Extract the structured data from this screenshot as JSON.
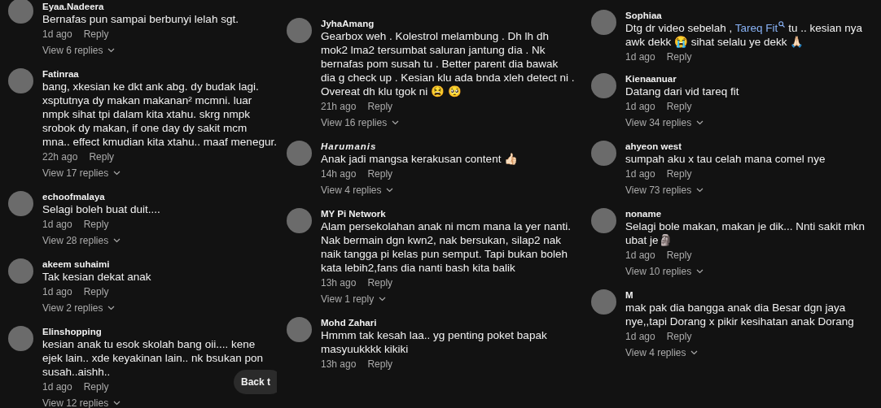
{
  "columns": [
    {
      "comments": [
        {
          "author": "Eyaa.Nadeera",
          "text": [
            {
              "kind": "plain",
              "text": "Bernafas pun sampai berbunyi lelah sgt."
            }
          ],
          "time": "1d ago",
          "reply": "Reply",
          "replies": "View 6 replies"
        },
        {
          "author": "Fatinraa",
          "text": [
            {
              "kind": "plain",
              "text": "bang, xkesian ke dkt ank abg. dy budak lagi. xsptutnya dy makan makanan² mcmni. luar nmpk sihat tpi dalam kita xtahu. skrg nmpk srobok dy makan, if one day dy sakit mcm mna.. effect kmudian kita xtahu.. maaf menegur."
            }
          ],
          "time": "22h ago",
          "reply": "Reply",
          "replies": "View 17 replies"
        },
        {
          "author": "echoofmalaya",
          "text": [
            {
              "kind": "plain",
              "text": "Selagi boleh buat duit...."
            }
          ],
          "time": "1d ago",
          "reply": "Reply",
          "replies": "View 28 replies"
        },
        {
          "author": "akeem suhaimi",
          "text": [
            {
              "kind": "plain",
              "text": "Tak kesian dekat anak"
            }
          ],
          "time": "1d ago",
          "reply": "Reply",
          "replies": "View 2 replies"
        },
        {
          "author": "Elinshopping",
          "text": [
            {
              "kind": "plain",
              "text": "kesian anak tu esok skolah bang oii.... kene ejek lain.. xde keyakinan lain.. nk bsukan pon susah..aishh.."
            }
          ],
          "time": "1d ago",
          "reply": "Reply",
          "replies": "View 12 replies"
        }
      ],
      "back_button": "Back t"
    },
    {
      "comments": [
        {
          "author": "JyhaAmang",
          "text": [
            {
              "kind": "plain",
              "text": "Gearbox weh . Kolestrol melambung . Dh lh dh mok2 lma2 tersumbat saluran jantung dia . Nk bernafas pom susah tu . Better parent dia bawak dia g check up . Kesian klu ada bnda xleh detect ni . Overeat dh klu tgok ni 😫 🥺"
            }
          ],
          "time": "21h ago",
          "reply": "Reply",
          "replies": "View 16 replies"
        },
        {
          "author": "Harumanis",
          "author_italic": true,
          "text": [
            {
              "kind": "plain",
              "text": "Anak jadi mangsa kerakusan content 👍🏻"
            }
          ],
          "time": "14h ago",
          "reply": "Reply",
          "replies": "View 4 replies"
        },
        {
          "author": "MY Pi Network",
          "text": [
            {
              "kind": "plain",
              "text": "Alam persekolahan anak ni mcm mana la yer nanti. Nak bermain dgn kwn2, nak bersukan, silap2 nak naik tangga pi kelas pun semput. Tapi bukan boleh kata lebih2,fans dia nanti bash kita balik"
            }
          ],
          "time": "13h ago",
          "reply": "Reply",
          "replies": "View 1 reply"
        },
        {
          "author": "Mohd Zahari",
          "text": [
            {
              "kind": "plain",
              "text": "Hmmm tak kesah laa.. yg penting poket bapak masyuukkkk kikiki"
            }
          ],
          "time": "13h ago",
          "reply": "Reply"
        }
      ]
    },
    {
      "comments": [
        {
          "author": "Sophiaa",
          "text": [
            {
              "kind": "plain",
              "text": "Dtg dr video sebelah , "
            },
            {
              "kind": "link",
              "text": "Tareq Fit"
            },
            {
              "kind": "plain",
              "text": " tu .. kesian nya awk dekk 😭 sihat selalu ye dekk 🙏🏻"
            }
          ],
          "time": "1d ago",
          "reply": "Reply"
        },
        {
          "author": "Kienaanuar",
          "text": [
            {
              "kind": "plain",
              "text": "Datang dari vid tareq fit"
            }
          ],
          "time": "1d ago",
          "reply": "Reply",
          "replies": "View 34 replies"
        },
        {
          "author": "ahyeon west",
          "text": [
            {
              "kind": "plain",
              "text": "sumpah aku x tau celah mana comel nye"
            }
          ],
          "time": "1d ago",
          "reply": "Reply",
          "replies": "View 73 replies"
        },
        {
          "author": "noname",
          "text": [
            {
              "kind": "plain",
              "text": "Selagi bole makan, makan je dik... Nnti sakit mkn ubat je🗿"
            }
          ],
          "time": "1d ago",
          "reply": "Reply",
          "replies": "View 10 replies"
        },
        {
          "author": "M",
          "text": [
            {
              "kind": "plain",
              "text": "mak pak dia bangga anak dia Besar dgn jaya nye,,tapi Dorang x pikir kesihatan anak Dorang"
            }
          ],
          "time": "1d ago",
          "reply": "Reply",
          "replies": "View 4 replies"
        }
      ]
    }
  ]
}
